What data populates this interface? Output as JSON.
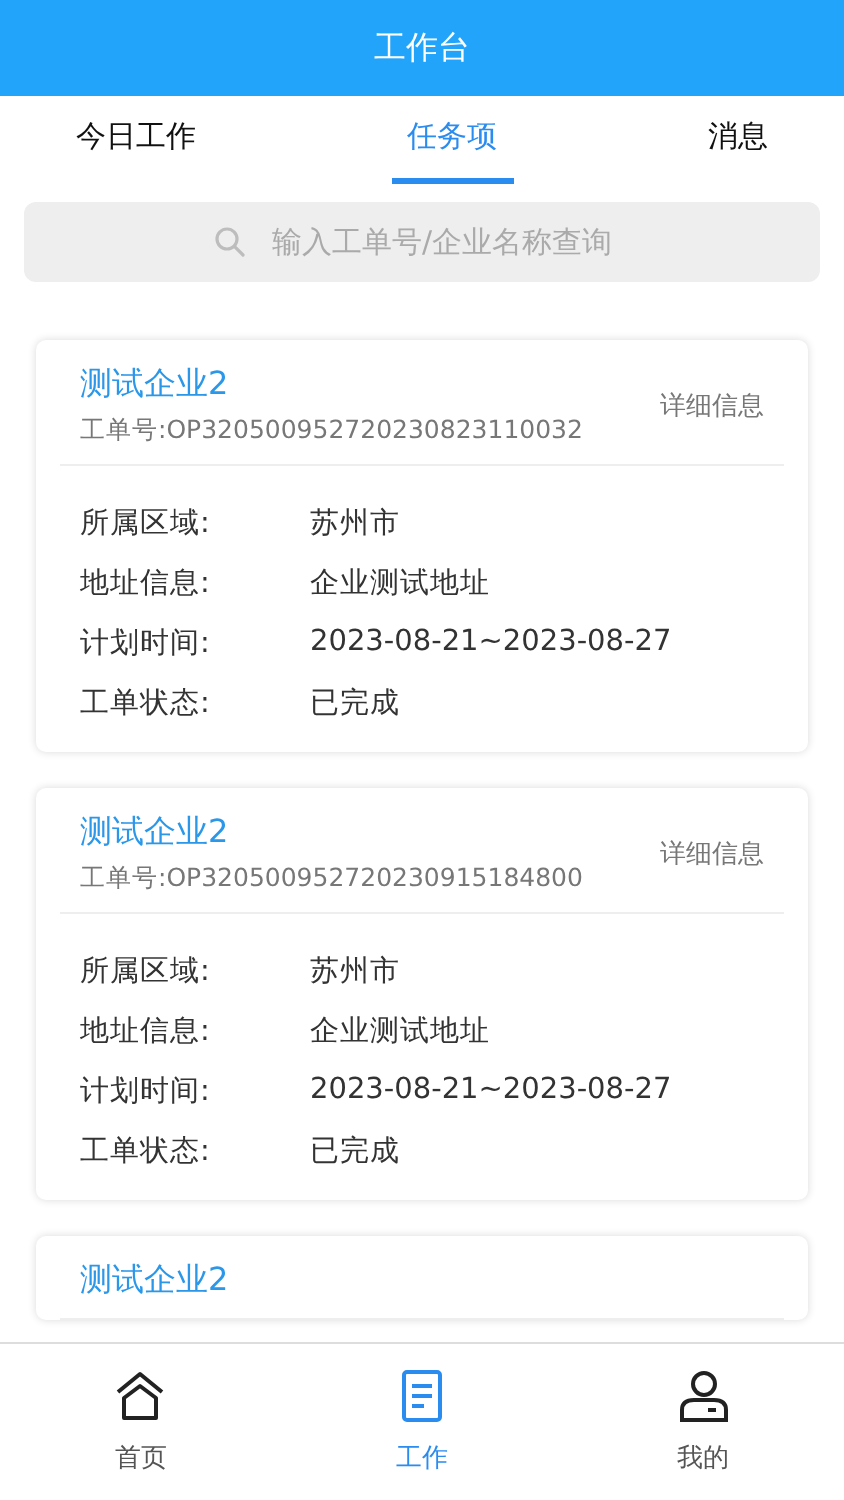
{
  "header": {
    "title": "工作台"
  },
  "tabs": [
    {
      "label": "今日工作",
      "selected": false
    },
    {
      "label": "任务项",
      "selected": true
    },
    {
      "label": "消息",
      "selected": false
    }
  ],
  "search": {
    "placeholder": "输入工单号/企业名称查询"
  },
  "cards": [
    {
      "company": "测试企业2",
      "order_no": "工单号:OP320500952720230823110032",
      "detail_link": "详细信息",
      "fields": [
        {
          "label": "所属区域:",
          "value": "苏州市"
        },
        {
          "label": "地址信息:",
          "value": "企业测试地址"
        },
        {
          "label": "计划时间:",
          "value": "2023-08-21~2023-08-27"
        },
        {
          "label": "工单状态:",
          "value": "已完成"
        }
      ]
    },
    {
      "company": "测试企业2",
      "order_no": "工单号:OP320500952720230915184800",
      "detail_link": "详细信息",
      "fields": [
        {
          "label": "所属区域:",
          "value": "苏州市"
        },
        {
          "label": "地址信息:",
          "value": "企业测试地址"
        },
        {
          "label": "计划时间:",
          "value": "2023-08-21~2023-08-27"
        },
        {
          "label": "工单状态:",
          "value": "已完成"
        }
      ]
    },
    {
      "company": "测试企业2"
    }
  ],
  "bottom_nav": [
    {
      "label": "首页",
      "kind": "home",
      "selected": false
    },
    {
      "label": "工作",
      "kind": "work",
      "selected": true
    },
    {
      "label": "我的",
      "kind": "profile",
      "selected": false
    }
  ]
}
